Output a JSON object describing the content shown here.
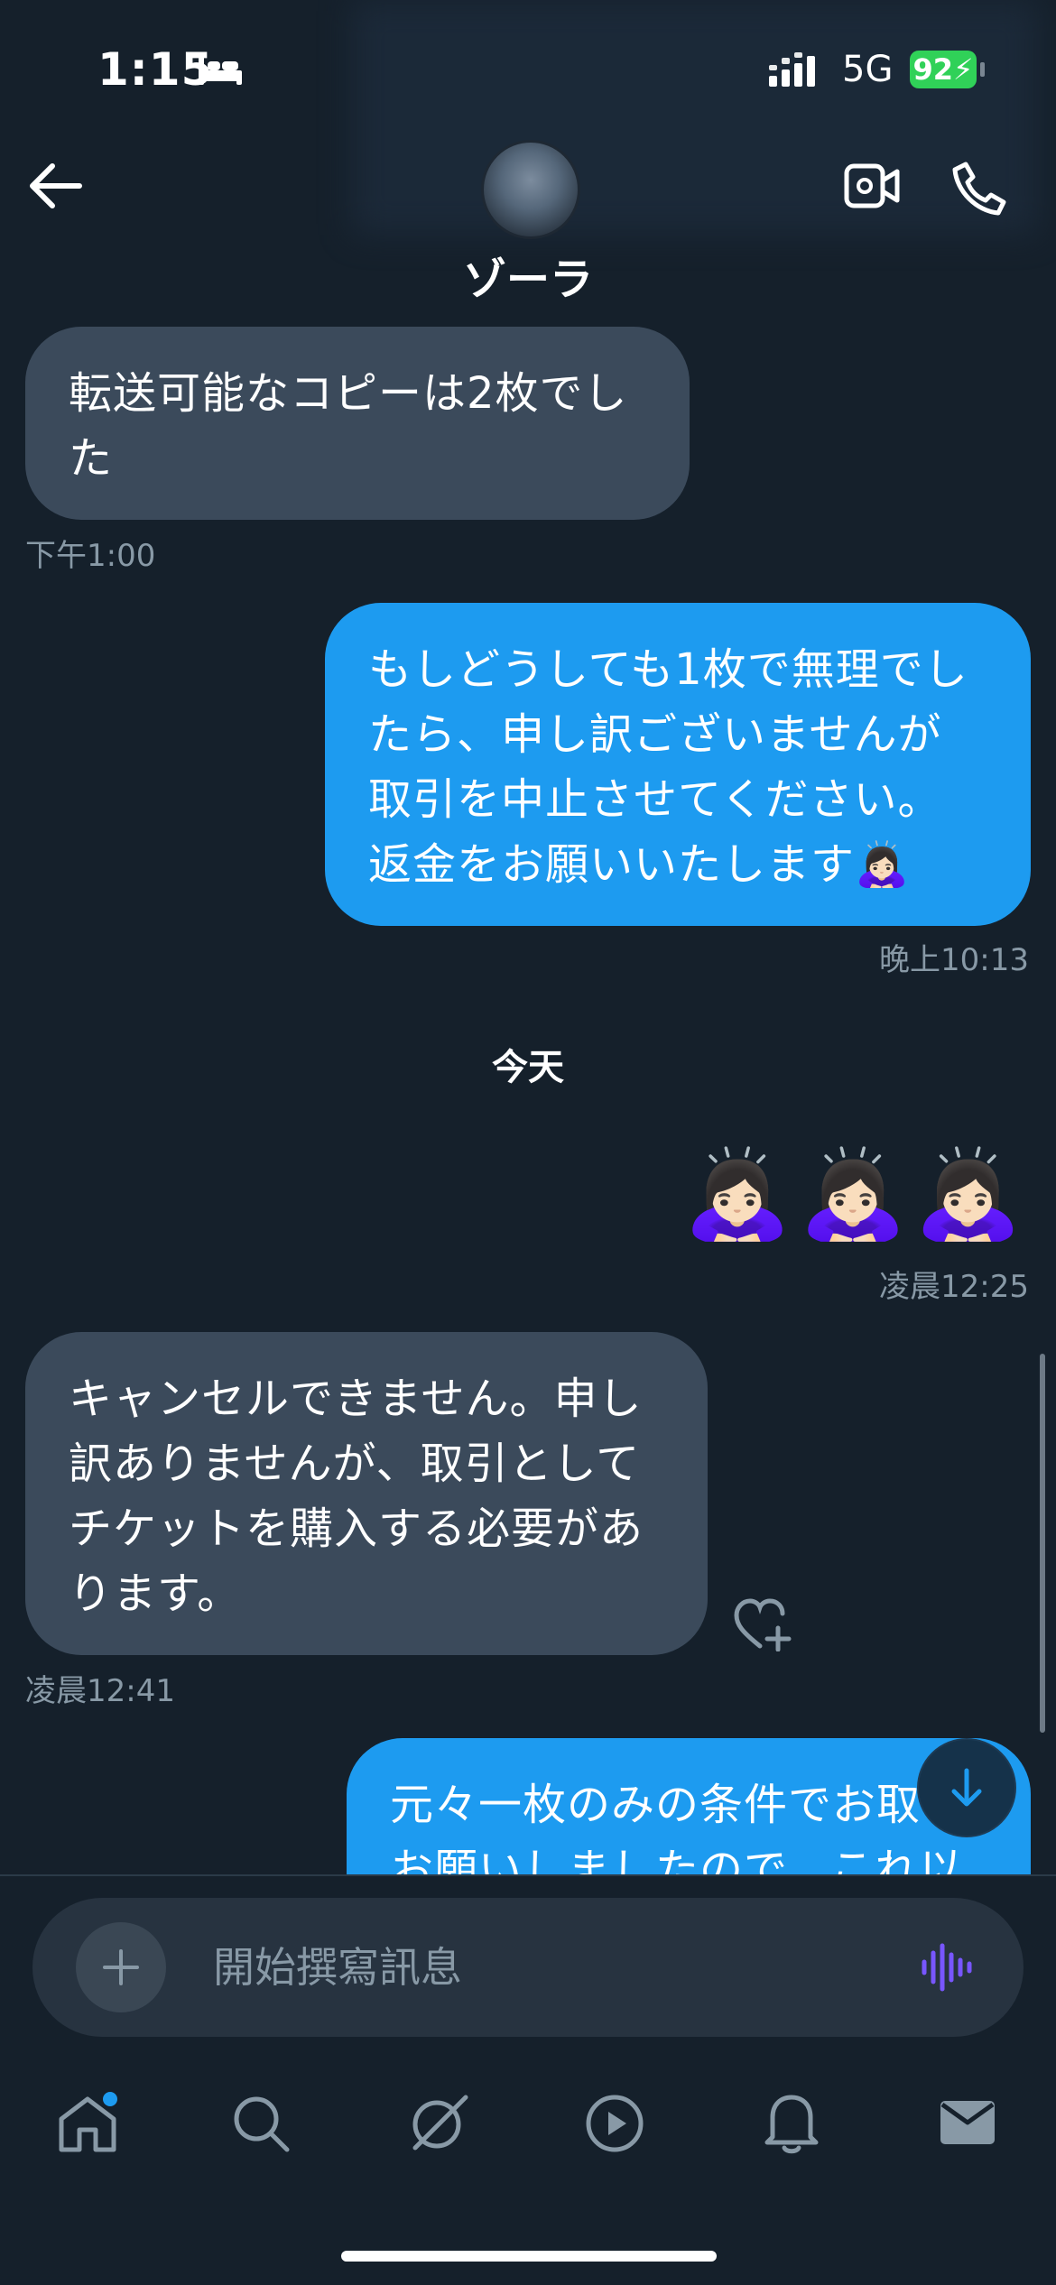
{
  "status_bar": {
    "time": "1:15",
    "network": "5G",
    "battery": "92"
  },
  "header": {
    "contact_name": "ゾーラ"
  },
  "messages": [
    {
      "direction": "incoming",
      "text_lines": [
        "転送可能なコピーは2枚でし",
        "た"
      ],
      "time": "下午1:00"
    },
    {
      "direction": "outgoing",
      "text_lines": [
        "もしどうしても1枚で無理でし",
        "たら、申し訳ございませんが",
        "取引を中止させてください。",
        "返金をお願いいたします🙇🏻‍♀️"
      ],
      "time": "晚上10:13"
    },
    {
      "direction": "outgoing",
      "emoji": "🙇🏻‍♀️🙇🏻‍♀️🙇🏻‍♀️",
      "time": "凌晨12:25"
    },
    {
      "direction": "incoming",
      "text_lines": [
        "キャンセルできません。申し",
        "訳ありませんが、取引として",
        "チケットを購入する必要があ",
        "ります。"
      ],
      "time": "凌晨12:41"
    },
    {
      "direction": "outgoing",
      "text_lines": [
        "元々一枚のみの条件でお取",
        "お願いしましたので、これ以"
      ]
    }
  ],
  "day_separator": "今天",
  "composer": {
    "placeholder": "開始撰寫訊息"
  },
  "tabs": [
    "home-icon",
    "search-icon",
    "grok-icon",
    "video-icon",
    "notifications-icon",
    "messages-icon"
  ],
  "colors": {
    "background": "#15202b",
    "incoming_bubble": "#3b4a5b",
    "outgoing_bubble": "#1d9bf0",
    "accent": "#1d9bf0",
    "voice_icon": "#7856ff"
  }
}
